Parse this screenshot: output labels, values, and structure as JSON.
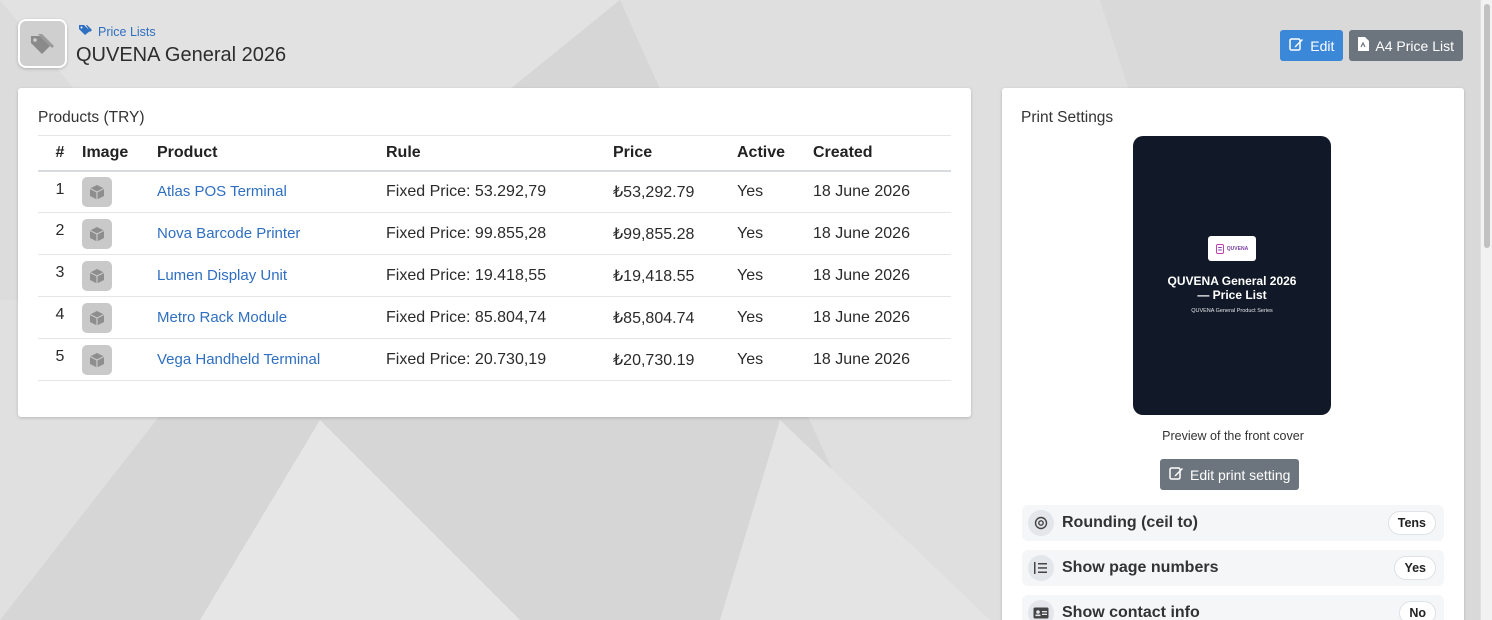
{
  "header": {
    "breadcrumb": "Price Lists",
    "title": "QUVENA General 2026",
    "edit_label": "Edit",
    "a4_label": "A4 Price List"
  },
  "products": {
    "title": "Products (TRY)",
    "columns": [
      "#",
      "Image",
      "Product",
      "Rule",
      "Price",
      "Active",
      "Created"
    ],
    "rows": [
      {
        "num": "1",
        "product": "Atlas POS Terminal",
        "rule": "Fixed Price: 53.292,79",
        "price": "₺53,292.79",
        "active": "Yes",
        "created": "18 June 2026"
      },
      {
        "num": "2",
        "product": "Nova Barcode Printer",
        "rule": "Fixed Price: 99.855,28",
        "price": "₺99,855.28",
        "active": "Yes",
        "created": "18 June 2026"
      },
      {
        "num": "3",
        "product": "Lumen Display Unit",
        "rule": "Fixed Price: 19.418,55",
        "price": "₺19,418.55",
        "active": "Yes",
        "created": "18 June 2026"
      },
      {
        "num": "4",
        "product": "Metro Rack Module",
        "rule": "Fixed Price: 85.804,74",
        "price": "₺85,804.74",
        "active": "Yes",
        "created": "18 June 2026"
      },
      {
        "num": "5",
        "product": "Vega Handheld Terminal",
        "rule": "Fixed Price: 20.730,19",
        "price": "₺20,730.19",
        "active": "Yes",
        "created": "18 June 2026"
      }
    ]
  },
  "print_settings": {
    "title": "Print Settings",
    "cover": {
      "logo_text": "QUVENA",
      "title": "QUVENA General 2026 — Price List",
      "subtitle": "QUVENA General Product Series"
    },
    "caption": "Preview of the front cover",
    "edit_button": "Edit print setting",
    "settings": [
      {
        "label": "Rounding (ceil to)",
        "value": "Tens",
        "icon": "target-icon"
      },
      {
        "label": "Show page numbers",
        "value": "Yes",
        "icon": "list-numbered-icon"
      },
      {
        "label": "Show contact info",
        "value": "No",
        "icon": "contact-card-icon"
      }
    ]
  },
  "colors": {
    "primary": "#3b87d8",
    "secondary": "#6c757d",
    "link": "#2f6fc1",
    "cover_bg": "#111827"
  }
}
